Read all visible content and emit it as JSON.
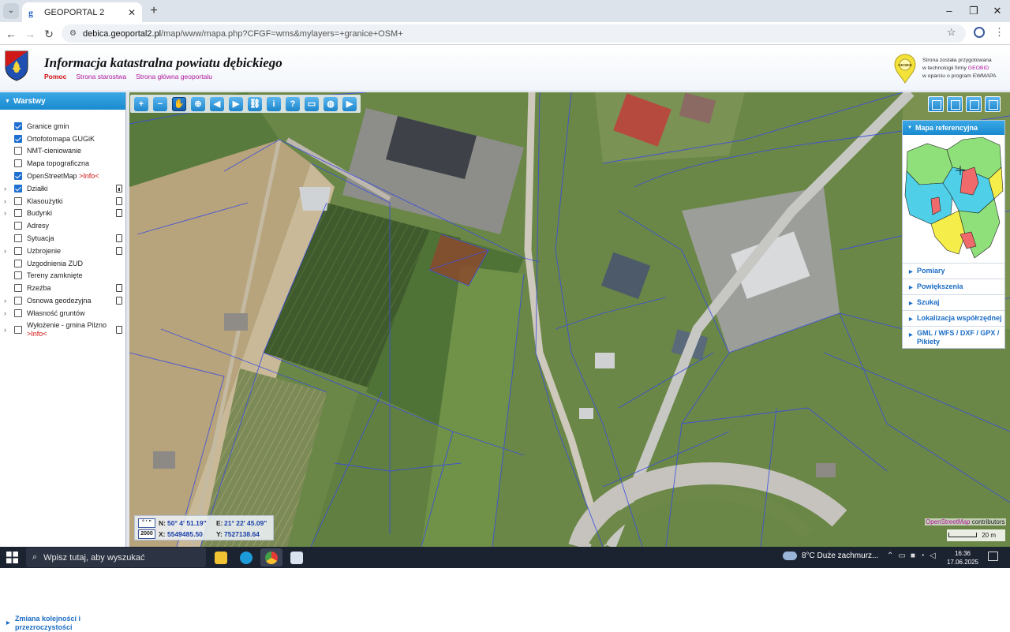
{
  "browser": {
    "tab_title": "GEOPORTAL 2",
    "url_domain": "debica.geoportal2.pl",
    "url_path": "/map/www/mapa.php?CFGF=wms&mylayers=+granice+OSM+"
  },
  "header": {
    "title": "Informacja katastralna powiatu dębickiego",
    "links": [
      "Pomoc",
      "Strona starostwa",
      "Strona główna geoportalu"
    ],
    "logo_text": "GEOBID",
    "note_line1": "Strona została przygotowana",
    "note_line2_pre": "w technologii firmy ",
    "note_brand": "GEOBID",
    "note_line3": "w oparciu o program EWMAPA"
  },
  "layers_panel": {
    "title": "Warstwy",
    "items": [
      {
        "label": "Granice gmin",
        "checked": true,
        "expandable": false,
        "doc": ""
      },
      {
        "label": "Ortofotomapa GUGiK",
        "checked": true,
        "expandable": false,
        "doc": ""
      },
      {
        "label": "NMT-cieniowanie",
        "checked": false,
        "expandable": false,
        "doc": ""
      },
      {
        "label": "Mapa topograficzna",
        "checked": false,
        "expandable": false,
        "doc": ""
      },
      {
        "label": "OpenStreetMap ",
        "info": ">Info<",
        "checked": true,
        "expandable": false,
        "doc": ""
      },
      {
        "label": "Działki",
        "checked": true,
        "expandable": true,
        "doc": "dl"
      },
      {
        "label": "Klasoużytki",
        "checked": false,
        "expandable": true,
        "doc": "doc"
      },
      {
        "label": "Budynki",
        "checked": false,
        "expandable": true,
        "doc": "doc"
      },
      {
        "label": "Adresy",
        "checked": false,
        "expandable": false,
        "doc": ""
      },
      {
        "label": "Sytuacja",
        "checked": false,
        "expandable": false,
        "doc": "doc"
      },
      {
        "label": "Uzbrojenie",
        "checked": false,
        "expandable": true,
        "doc": "doc"
      },
      {
        "label": "Uzgodnienia ZUD",
        "checked": false,
        "expandable": false,
        "doc": ""
      },
      {
        "label": "Tereny zamknięte",
        "checked": false,
        "expandable": false,
        "doc": ""
      },
      {
        "label": "Rzeźba",
        "checked": false,
        "expandable": false,
        "doc": "doc"
      },
      {
        "label": "Osnowa geodezyjna",
        "checked": false,
        "expandable": true,
        "doc": "doc"
      },
      {
        "label": "Własność gruntów",
        "checked": false,
        "expandable": true,
        "doc": ""
      },
      {
        "label": "Wyłożenie - gmina Pilzno",
        "info": ">Info<",
        "checked": false,
        "expandable": true,
        "doc": "doc"
      }
    ],
    "reorder_line1": "Zmiana kolejności i",
    "reorder_line2": "przezroczystości"
  },
  "toolbar": [
    {
      "name": "zoom-in",
      "glyph": "+"
    },
    {
      "name": "zoom-out",
      "glyph": "−"
    },
    {
      "name": "pan-hand",
      "glyph": "✋"
    },
    {
      "name": "zoom-extent",
      "glyph": "⊕"
    },
    {
      "name": "back-arrow",
      "glyph": "◀"
    },
    {
      "name": "forward-arrow",
      "glyph": "▶"
    },
    {
      "name": "link",
      "glyph": "⛓"
    },
    {
      "name": "info",
      "glyph": "i"
    },
    {
      "name": "identify-parcel",
      "glyph": "?"
    },
    {
      "name": "measure",
      "glyph": "▭"
    },
    {
      "name": "globe",
      "glyph": "◍"
    },
    {
      "name": "camera",
      "glyph": "▶"
    }
  ],
  "right_panel": {
    "title": "Mapa referencyjna",
    "items": [
      "Pomiary",
      "Powiększenia",
      "Szukaj",
      "Lokalizacja współrzędnej"
    ],
    "export_line1": "GML / WFS / DXF / GPX /",
    "export_line2": "Pikiety"
  },
  "coords": {
    "btn_deg": "° ' \"",
    "btn_2000": "2000",
    "n_label": "N:",
    "n_value": "50° 4' 51.19\"",
    "e_label": "E:",
    "e_value": "21° 22' 45.09\"",
    "x_label": "X:",
    "x_value": "5549485.50",
    "y_label": "Y:",
    "y_value": "7527138.64"
  },
  "attribution": {
    "osm": "OpenStreetMap",
    "rest": " contributors"
  },
  "scale": "20 m",
  "taskbar": {
    "search_placeholder": "Wpisz tutaj, aby wyszukać",
    "weather": "8°C  Duże zachmurz...",
    "time": "16:36",
    "date": "17.06.2025"
  },
  "colors": {
    "accent_blue": "#1a8ad0",
    "link_magenta": "#b0189c",
    "link_red": "#d01010",
    "parcel_line": "#3a4de0",
    "selected_parcel": "#b03a2a"
  }
}
